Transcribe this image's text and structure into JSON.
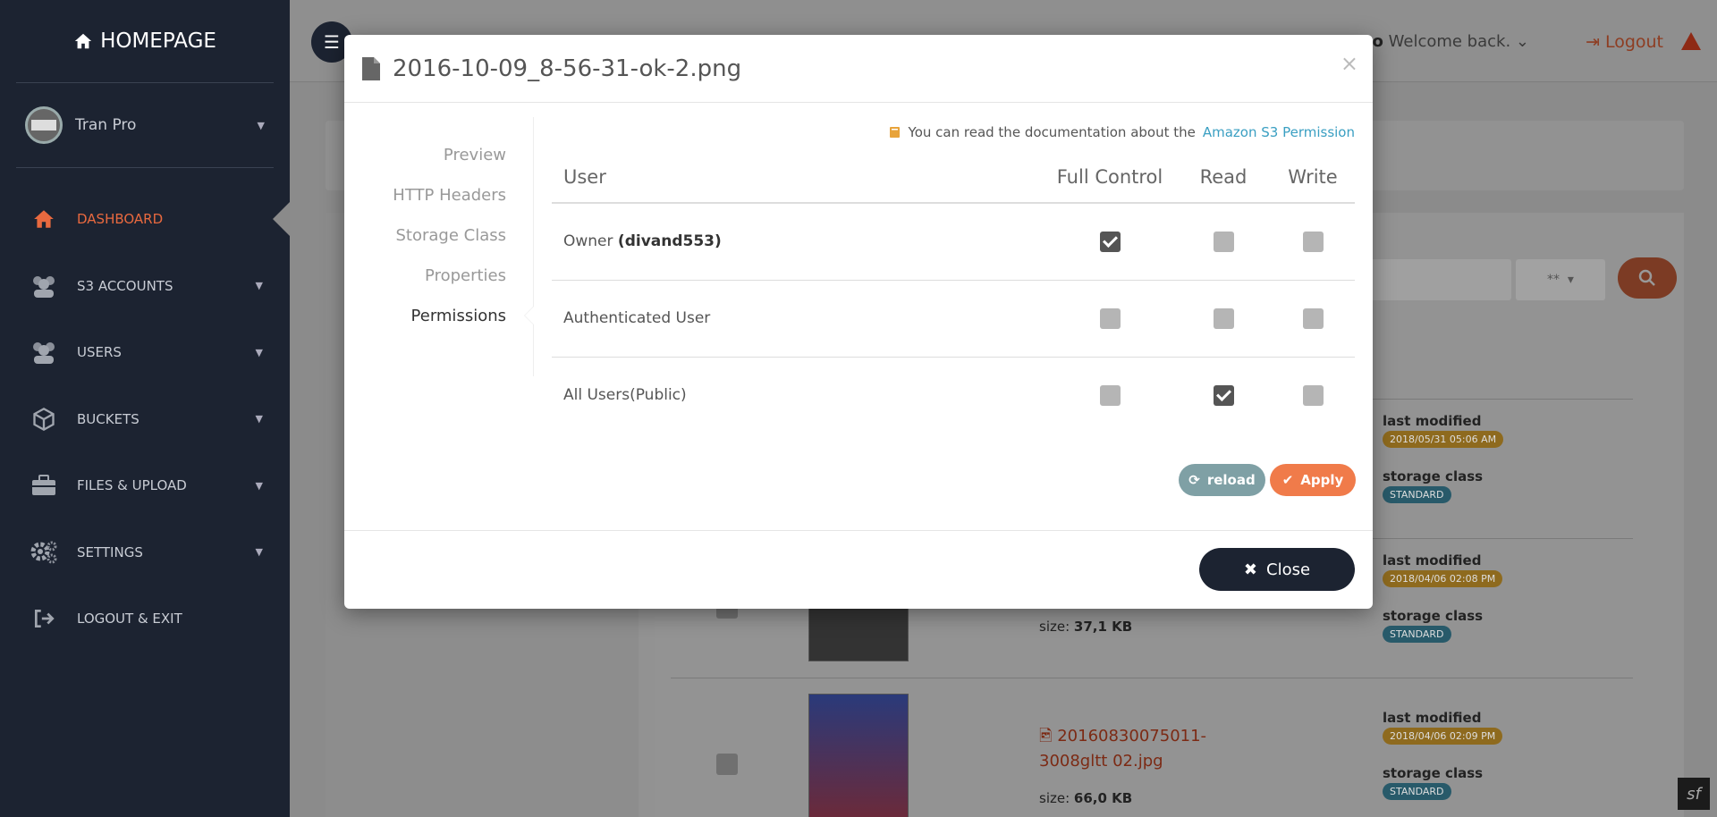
{
  "sidebar": {
    "brand": "HOMEPAGE",
    "user_name": "Tran Pro",
    "items": [
      {
        "label": "DASHBOARD"
      },
      {
        "label": "S3 ACCOUNTS"
      },
      {
        "label": "USERS"
      },
      {
        "label": "BUCKETS"
      },
      {
        "label": "FILES & UPLOAD"
      },
      {
        "label": "SETTINGS"
      },
      {
        "label": "LOGOUT & EXIT"
      }
    ]
  },
  "topbar": {
    "user_name": "Tran Pro",
    "welcome": "Welcome back.",
    "logout": "Logout"
  },
  "background": {
    "select_value": "**",
    "files": [
      {
        "last_modified_label": "last modified",
        "last_modified": "2018/05/31 05:06 AM",
        "storage_class_label": "storage class",
        "storage_class": "STANDARD"
      },
      {
        "last_modified_label": "last modified",
        "last_modified": "2018/04/06 02:08 PM",
        "storage_class_label": "storage class",
        "storage_class": "STANDARD",
        "size_label": "size:",
        "size": "37,1 KB"
      },
      {
        "name": "20160830075011-3008gltt 02.jpg",
        "last_modified_label": "last modified",
        "last_modified": "2018/04/06 02:09 PM",
        "storage_class_label": "storage class",
        "storage_class": "STANDARD",
        "size_label": "size:",
        "size": "66,0 KB"
      }
    ]
  },
  "modal": {
    "title": "2016-10-09_8-56-31-ok-2.png",
    "tabs": [
      "Preview",
      "HTTP Headers",
      "Storage Class",
      "Properties",
      "Permissions"
    ],
    "active_tab": "Permissions",
    "doc_note": "You can read the documentation about the",
    "doc_link": "Amazon S3 Permission",
    "table": {
      "headers": [
        "User",
        "Full Control",
        "Read",
        "Write"
      ],
      "rows": [
        {
          "user": "Owner",
          "user_detail": "(divand553)",
          "full_control": true,
          "read": false,
          "write": false
        },
        {
          "user": "Authenticated User",
          "user_detail": "",
          "full_control": false,
          "read": false,
          "write": false
        },
        {
          "user": "All Users(Public)",
          "user_detail": "",
          "full_control": false,
          "read": true,
          "write": false
        }
      ]
    },
    "reload_label": "reload",
    "apply_label": "Apply",
    "close_label": "Close"
  },
  "colors": {
    "accent": "#e8693f",
    "sidebar_bg": "#1c2331",
    "link": "#3a9fc2",
    "apply": "#f07b4a",
    "reload": "#7fa0a5"
  }
}
